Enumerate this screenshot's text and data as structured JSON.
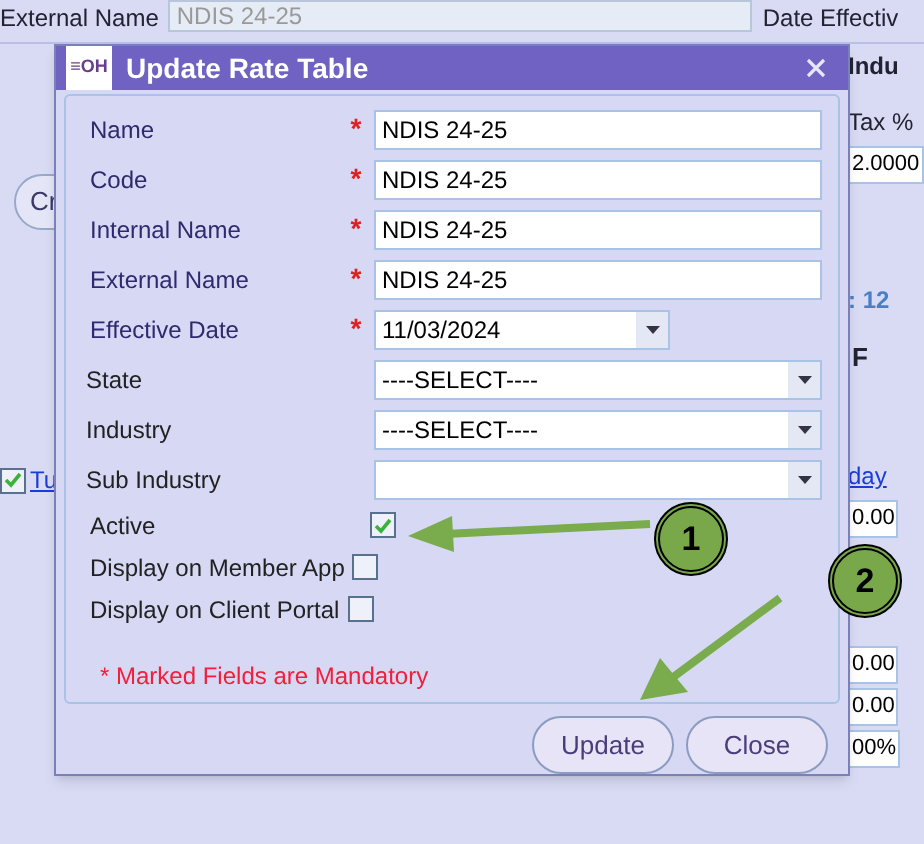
{
  "background": {
    "top_label": "External Name",
    "top_value": "NDIS 24-25",
    "top_label_2": "Date Effectiv",
    "left": {
      "button": "Cr",
      "link": "Tu",
      "link_checked": true
    },
    "right": [
      {
        "kind": "header",
        "text": "Indu"
      },
      {
        "kind": "label",
        "text": "Tax %"
      },
      {
        "kind": "value",
        "text": "2.0000"
      },
      {
        "kind": "count",
        "text": ": 12"
      },
      {
        "kind": "select",
        "text": "F"
      },
      {
        "kind": "link",
        "text": "day"
      },
      {
        "kind": "value",
        "text": "0.00"
      },
      {
        "kind": "value",
        "text": "0.00"
      },
      {
        "kind": "value",
        "text": "0.00"
      },
      {
        "kind": "value",
        "text": "00%"
      }
    ]
  },
  "dialog": {
    "title": "Update Rate Table",
    "logo": "≡OH",
    "required_mark": "*",
    "fields": [
      {
        "kind": "text",
        "label": "Name",
        "required": true,
        "value": "NDIS 24-25"
      },
      {
        "kind": "text",
        "label": "Code",
        "required": true,
        "value": "NDIS 24-25"
      },
      {
        "kind": "text",
        "label": "Internal Name",
        "required": true,
        "value": "NDIS 24-25"
      },
      {
        "kind": "text",
        "label": "External Name",
        "required": true,
        "value": "NDIS 24-25"
      },
      {
        "kind": "date",
        "label": "Effective Date",
        "required": true,
        "value": "11/03/2024"
      },
      {
        "kind": "select",
        "label": "State",
        "required": false,
        "value": "----SELECT----"
      },
      {
        "kind": "select",
        "label": "Industry",
        "required": false,
        "value": "----SELECT----"
      },
      {
        "kind": "select",
        "label": "Sub Industry",
        "required": false
      },
      {
        "kind": "checkbox",
        "label": "Active",
        "checked": true
      },
      {
        "kind": "checkbox",
        "label": "Display on Member App",
        "checked": false
      },
      {
        "kind": "checkbox",
        "label": "Display on Client Portal",
        "checked": false
      }
    ],
    "note": "* Marked Fields are Mandatory",
    "buttons": [
      "Update",
      "Close"
    ]
  },
  "callouts": [
    "1",
    "2"
  ]
}
